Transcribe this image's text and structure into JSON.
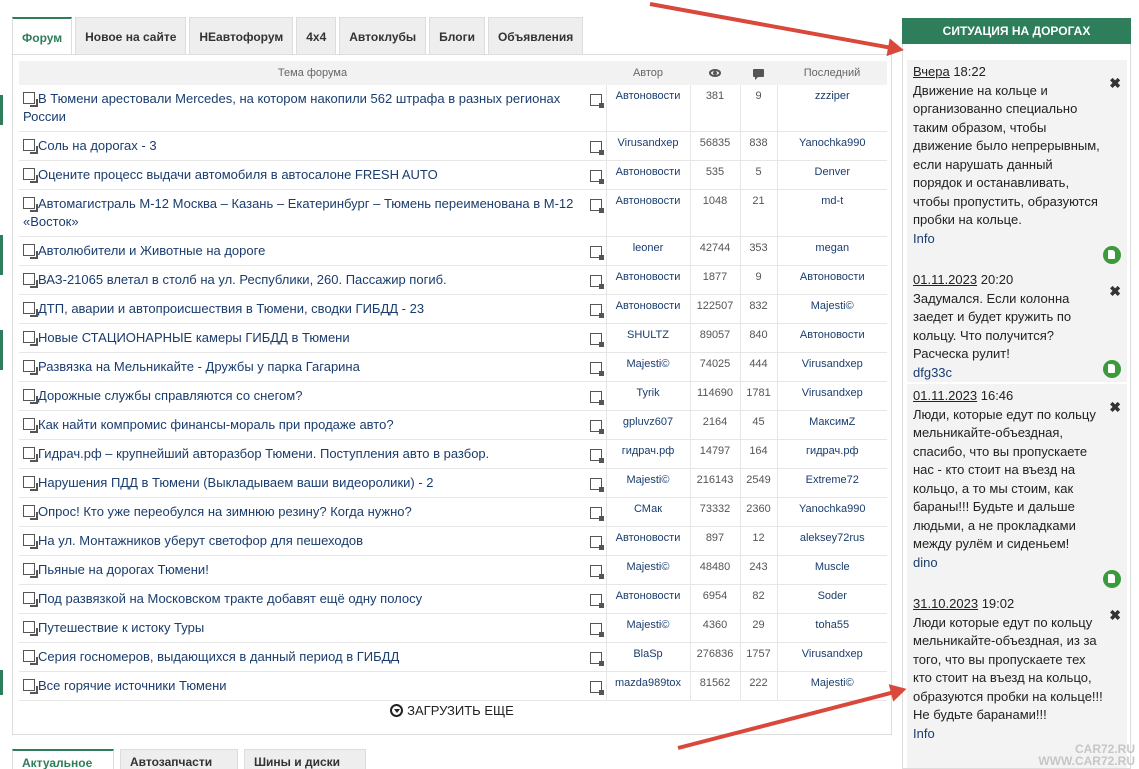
{
  "tabs": [
    "Форум",
    "Новое на сайте",
    "НЕавтофорум",
    "4x4",
    "Автоклубы",
    "Блоги",
    "Объявления"
  ],
  "table": {
    "headers": {
      "topic": "Тема форума",
      "author": "Автор",
      "last": "Последний"
    },
    "rows": [
      {
        "topic": "В Тюмени арестовали Mercedes, на котором накопили 562 штрафа в разных регионах России",
        "author": "Автоновости",
        "views": "381",
        "replies": "9",
        "last": "zzziper"
      },
      {
        "topic": "Соль на дорогах - 3",
        "author": "Virusandxep",
        "views": "56835",
        "replies": "838",
        "last": "Yanochka990"
      },
      {
        "topic": "Оцените процесс выдачи автомобиля в автосалоне FRESH AUTO",
        "author": "Автоновости",
        "views": "535",
        "replies": "5",
        "last": "Denver"
      },
      {
        "topic": "Автомагистраль М-12 Москва – Казань – Екатеринбург – Тюмень переименована в М-12 «Восток»",
        "author": "Автоновости",
        "views": "1048",
        "replies": "21",
        "last": "md-t"
      },
      {
        "topic": "Автолюбители и Животные на дороге",
        "author": "leoner",
        "views": "42744",
        "replies": "353",
        "last": "megan"
      },
      {
        "topic": "ВАЗ-21065 влетал в столб на ул. Республики, 260. Пассажир погиб.",
        "author": "Автоновости",
        "views": "1877",
        "replies": "9",
        "last": "Автоновости"
      },
      {
        "topic": "ДТП, аварии и автопроисшествия в Тюмени, сводки ГИБДД - 23",
        "author": "Автоновости",
        "views": "122507",
        "replies": "832",
        "last": "Majesti©"
      },
      {
        "topic": "Новые СТАЦИОНАРНЫЕ камеры ГИБДД в Тюмени",
        "author": "SHULTZ",
        "views": "89057",
        "replies": "840",
        "last": "Автоновости"
      },
      {
        "topic": "Развязка на Мельникайте - Дружбы у парка Гагарина",
        "author": "Majesti©",
        "views": "74025",
        "replies": "444",
        "last": "Virusandxep"
      },
      {
        "topic": "Дорожные службы справляются со снегом?",
        "author": "Tyrik",
        "views": "114690",
        "replies": "1781",
        "last": "Virusandxep"
      },
      {
        "topic": "Как найти компромис финансы-мораль при продаже авто?",
        "author": "gpluvz607",
        "views": "2164",
        "replies": "45",
        "last": "МаксимZ"
      },
      {
        "topic": "Гидрач.рф – крупнейший авторазбор Тюмени. Поступления авто в разбор.",
        "author": "гидрач.рф",
        "views": "14797",
        "replies": "164",
        "last": "гидрач.рф"
      },
      {
        "topic": "Нарушения ПДД в Тюмени (Выкладываем ваши видеоролики) - 2",
        "author": "Majesti©",
        "views": "216143",
        "replies": "2549",
        "last": "Extreme72"
      },
      {
        "topic": "Опрос! Кто уже переобулся на зимнюю резину? Когда нужно?",
        "author": "СМак",
        "views": "73332",
        "replies": "2360",
        "last": "Yanochka990"
      },
      {
        "topic": "На ул. Монтажников уберут светофор для пешеходов",
        "author": "Автоновости",
        "views": "897",
        "replies": "12",
        "last": "aleksey72rus"
      },
      {
        "topic": "Пьяные на дорогах Тюмени!",
        "author": "Majesti©",
        "views": "48480",
        "replies": "243",
        "last": "Muscle"
      },
      {
        "topic": "Под развязкой на Московском тракте добавят ещё одну полосу",
        "author": "Автоновости",
        "views": "6954",
        "replies": "82",
        "last": "Soder"
      },
      {
        "topic": "Путешествие к истоку Туры",
        "author": "Majesti©",
        "views": "4360",
        "replies": "29",
        "last": "toha55"
      },
      {
        "topic": "Серия госномеров, выдающихся в данный период в ГИБДД",
        "author": "BlaSp",
        "views": "276836",
        "replies": "1757",
        "last": "Virusandxep"
      },
      {
        "topic": "Все горячие источники Тюмени",
        "author": "mazda989tox",
        "views": "81562",
        "replies": "222",
        "last": "Majesti©"
      }
    ]
  },
  "load_more": "ЗАГРУЗИТЬ ЕЩЕ",
  "bottom_tabs": [
    "Актуальное",
    "Автозапчасти",
    "Шины и диски"
  ],
  "sidebar": {
    "title": "СИТУАЦИЯ НА ДОРОГАХ",
    "messages": [
      {
        "date": "Вчера",
        "time": "18:22",
        "text": "Движение на кольце и организованно специально таким образом, чтобы движение было непрерывным, если нарушать данный порядок и останавливать, чтобы пропустить, образуются пробки на кольце.",
        "author": "Info"
      },
      {
        "date": "01.11.2023",
        "time": "20:20",
        "text": "Задумался. Если колонна заедет и будет кружить по кольцу. Что получится? Расческа рулит!",
        "author": "dfg33c"
      },
      {
        "date": "01.11.2023",
        "time": "16:46",
        "text": "Люди, которые едут по кольцу мельникайте-объездная, спасибо, что вы пропускаете нас - кто стоит на въезд на кольцо, а то мы стоим, как бараны!!! Будьте и дальше людьми, а не прокладками между рулём и сиденьем!",
        "author": "dino"
      },
      {
        "date": "31.10.2023",
        "time": "19:02",
        "text": "Люди которые едут по кольцу мельникайте-объездная, из за того, что вы пропускаете тех кто стоит на въезд на кольцо, образуются пробки на кольце!!! Не будьте баранами!!!",
        "author": "Info"
      }
    ]
  },
  "watermark": {
    "line1": "CAR72.RU",
    "line2": "WWW.CAR72.RU"
  }
}
